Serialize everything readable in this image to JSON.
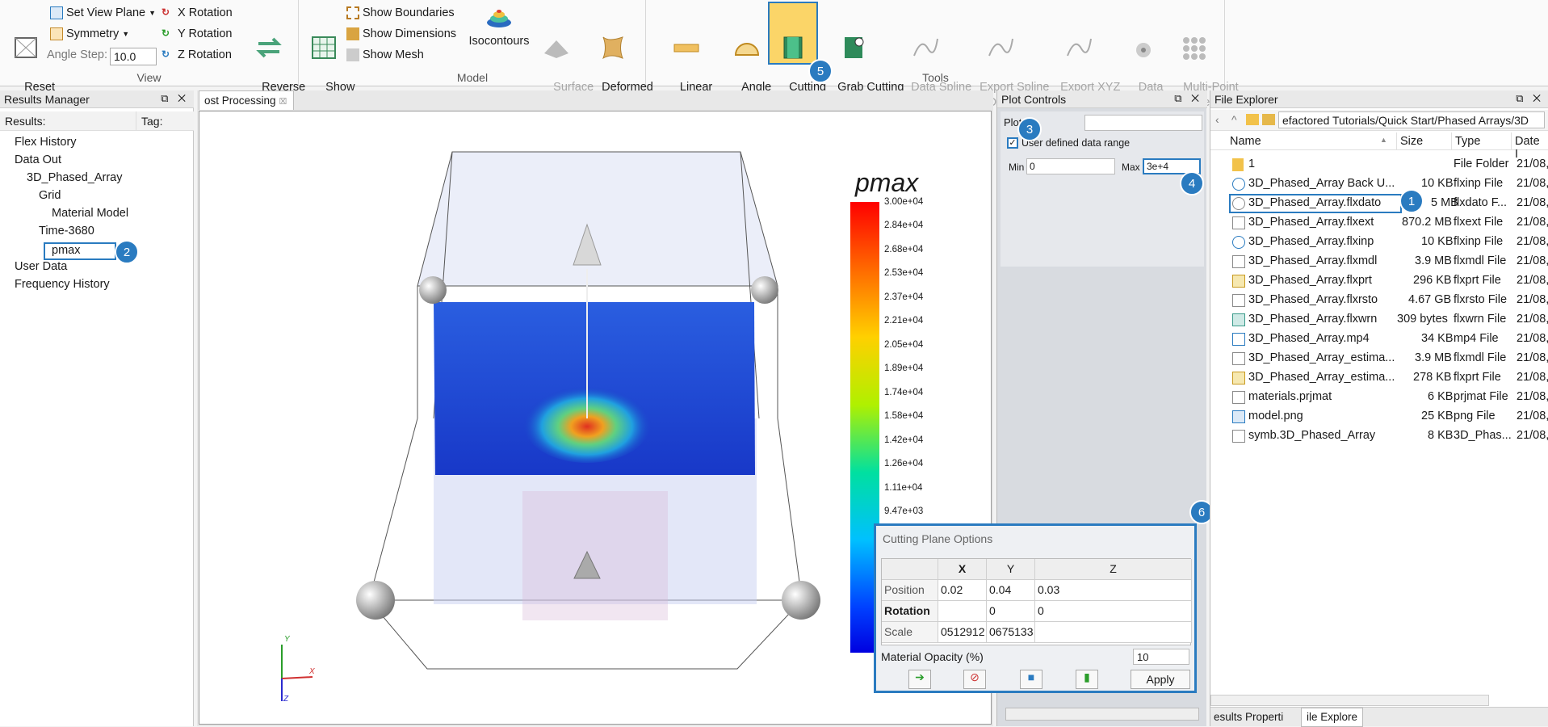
{
  "ribbon": {
    "reset_view": "Reset\nView",
    "set_view_plane": "Set View Plane",
    "symmetry": "Symmetry",
    "angle_step_label": "Angle Step:",
    "angle_step_value": "10.0",
    "x_rotation": "X Rotation",
    "y_rotation": "Y Rotation",
    "z_rotation": "Z Rotation",
    "reverse_rotation": "Reverse\nrotation",
    "view_group": "View",
    "show_grid": "Show\nGrid",
    "show_boundaries": "Show Boundaries",
    "show_dimensions": "Show Dimensions",
    "show_mesh": "Show Mesh",
    "isocontours": "Isocontours",
    "surface_plot": "Surface\nPlot",
    "deformed_grid_plot": "Deformed\nGrid Plot",
    "model_group": "Model",
    "linear_measure": "Linear\nMeasure",
    "angle_measure": "Angle\nMeasure",
    "cutting_plane": "Cutting\nPlane",
    "grab_cutting_plane": "Grab Cutting\nPlane",
    "data_spline_tool": "Data Spline\nTool",
    "export_spline_data": "Export Spline\nData",
    "export_xyz_spline_data": "Export XYZ\nSpline Data",
    "data_probe": "Data\nProbe",
    "multi_point_probe": "Multi-Point\nProbe",
    "tools_group": "Tools"
  },
  "results_manager": {
    "title": "Results Manager",
    "col_results": "Results:",
    "col_tag": "Tag:",
    "tree": [
      "Flex History",
      "Data Out",
      "3D_Phased_Array",
      "Grid",
      "Material Model",
      "Time-3680",
      "pmax",
      "User Data",
      "Frequency History"
    ]
  },
  "viewport": {
    "tab_label": "ost Processing",
    "legend_title": "pmax",
    "legend_ticks": [
      "3.00e+04",
      "2.84e+04",
      "2.68e+04",
      "2.53e+04",
      "2.37e+04",
      "2.21e+04",
      "2.05e+04",
      "1.89e+04",
      "1.74e+04",
      "1.58e+04",
      "1.42e+04",
      "1.26e+04",
      "1.11e+04",
      "9.47e+03"
    ],
    "axis_y": "Y",
    "axis_x": "X",
    "axis_z": "Z"
  },
  "plot_controls": {
    "title": "Plot Controls",
    "plot_label": "Plot",
    "user_defined_range": "User defined data range",
    "min_label": "Min",
    "min_value": "0",
    "max_label": "Max",
    "max_value": "3e+4"
  },
  "cutting_plane_options": {
    "title": "Cutting Plane Options",
    "col_x": "X",
    "col_y": "Y",
    "col_z": "Z",
    "position_label": "Position",
    "position": [
      "0.02",
      "0.04",
      "0.03"
    ],
    "rotation_label": "Rotation",
    "rotation": [
      "",
      "0",
      "0"
    ],
    "scale_label": "Scale",
    "scale": [
      "0512912",
      "0675133",
      ""
    ],
    "opacity_label": "Material Opacity (%)",
    "opacity_value": "10",
    "apply": "Apply"
  },
  "file_explorer": {
    "title": "File Explorer",
    "path": "efactored Tutorials/Quick Start/Phased Arrays/3D",
    "col_name": "Name",
    "col_size": "Size",
    "col_type": "Type",
    "col_date": "Date I",
    "files": [
      {
        "name": "1",
        "size": "",
        "type": "File Folder",
        "date": "21/08,"
      },
      {
        "name": "3D_Phased_Array Back U...",
        "size": "10 KB",
        "type": "flxinp File",
        "date": "21/08,"
      },
      {
        "name": "3D_Phased_Array.flxdato",
        "size": "5 MB",
        "type": "flxdato F...",
        "date": "21/08,"
      },
      {
        "name": "3D_Phased_Array.flxext",
        "size": "870.2 MB",
        "type": "flxext File",
        "date": "21/08,"
      },
      {
        "name": "3D_Phased_Array.flxinp",
        "size": "10 KB",
        "type": "flxinp File",
        "date": "21/08,"
      },
      {
        "name": "3D_Phased_Array.flxmdl",
        "size": "3.9 MB",
        "type": "flxmdl File",
        "date": "21/08,"
      },
      {
        "name": "3D_Phased_Array.flxprt",
        "size": "296 KB",
        "type": "flxprt File",
        "date": "21/08,"
      },
      {
        "name": "3D_Phased_Array.flxrsto",
        "size": "4.67 GB",
        "type": "flxrsto File",
        "date": "21/08,"
      },
      {
        "name": "3D_Phased_Array.flxwrn",
        "size": "309 bytes",
        "type": "flxwrn File",
        "date": "21/08,"
      },
      {
        "name": "3D_Phased_Array.mp4",
        "size": "34 KB",
        "type": "mp4 File",
        "date": "21/08,"
      },
      {
        "name": "3D_Phased_Array_estima...",
        "size": "3.9 MB",
        "type": "flxmdl File",
        "date": "21/08,"
      },
      {
        "name": "3D_Phased_Array_estima...",
        "size": "278 KB",
        "type": "flxprt File",
        "date": "21/08,"
      },
      {
        "name": "materials.prjmat",
        "size": "6 KB",
        "type": "prjmat File",
        "date": "21/08,"
      },
      {
        "name": "model.png",
        "size": "25 KB",
        "type": "png File",
        "date": "21/08,"
      },
      {
        "name": "symb.3D_Phased_Array",
        "size": "8 KB",
        "type": "3D_Phas...",
        "date": "21/08,"
      }
    ],
    "tab_results_props": "esults Properti",
    "tab_file_explorer": "ile Explore"
  },
  "badges": [
    "1",
    "2",
    "3",
    "4",
    "5",
    "6"
  ],
  "colors": {
    "accent": "#2a7bc0",
    "selected": "#fbd568"
  }
}
